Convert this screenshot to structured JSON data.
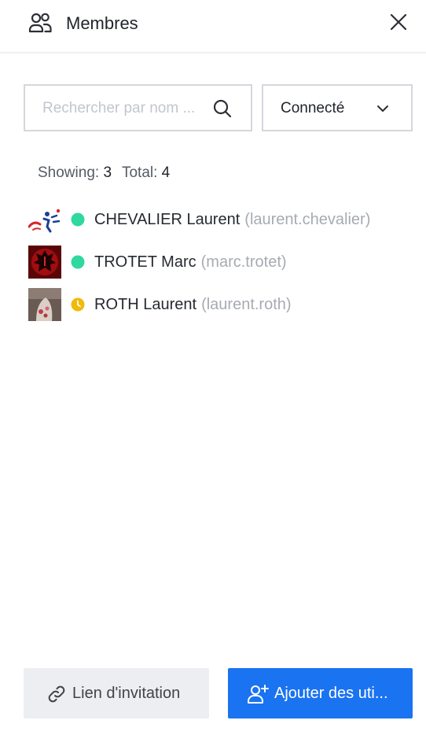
{
  "header": {
    "title": "Membres",
    "icon": "users-icon",
    "close_icon": "close-icon"
  },
  "search": {
    "placeholder": "Rechercher par nom ...",
    "value": "",
    "icon": "search-icon"
  },
  "status_filter": {
    "selected": "Connecté",
    "icon": "chevron-down-icon"
  },
  "counts": {
    "showing_label": "Showing:",
    "showing_value": "3",
    "total_label": "Total:",
    "total_value": "4"
  },
  "members": [
    {
      "name": "CHEVALIER Laurent",
      "username": "(laurent.chevalier)",
      "status": "online",
      "status_color": "#2fd8a0"
    },
    {
      "name": "TROTET Marc",
      "username": "(marc.trotet)",
      "status": "online",
      "status_color": "#2fd8a0"
    },
    {
      "name": "ROTH Laurent",
      "username": "(laurent.roth)",
      "status": "away",
      "status_color": "#f1b90a"
    }
  ],
  "footer": {
    "invite_label": "Lien d'invitation",
    "invite_icon": "link-icon",
    "add_label": "Ajouter des uti...",
    "add_icon": "add-user-icon"
  },
  "colors": {
    "primary": "#1a73f0",
    "online": "#2fd8a0",
    "away": "#f1b90a",
    "border": "#d4d7dc"
  }
}
